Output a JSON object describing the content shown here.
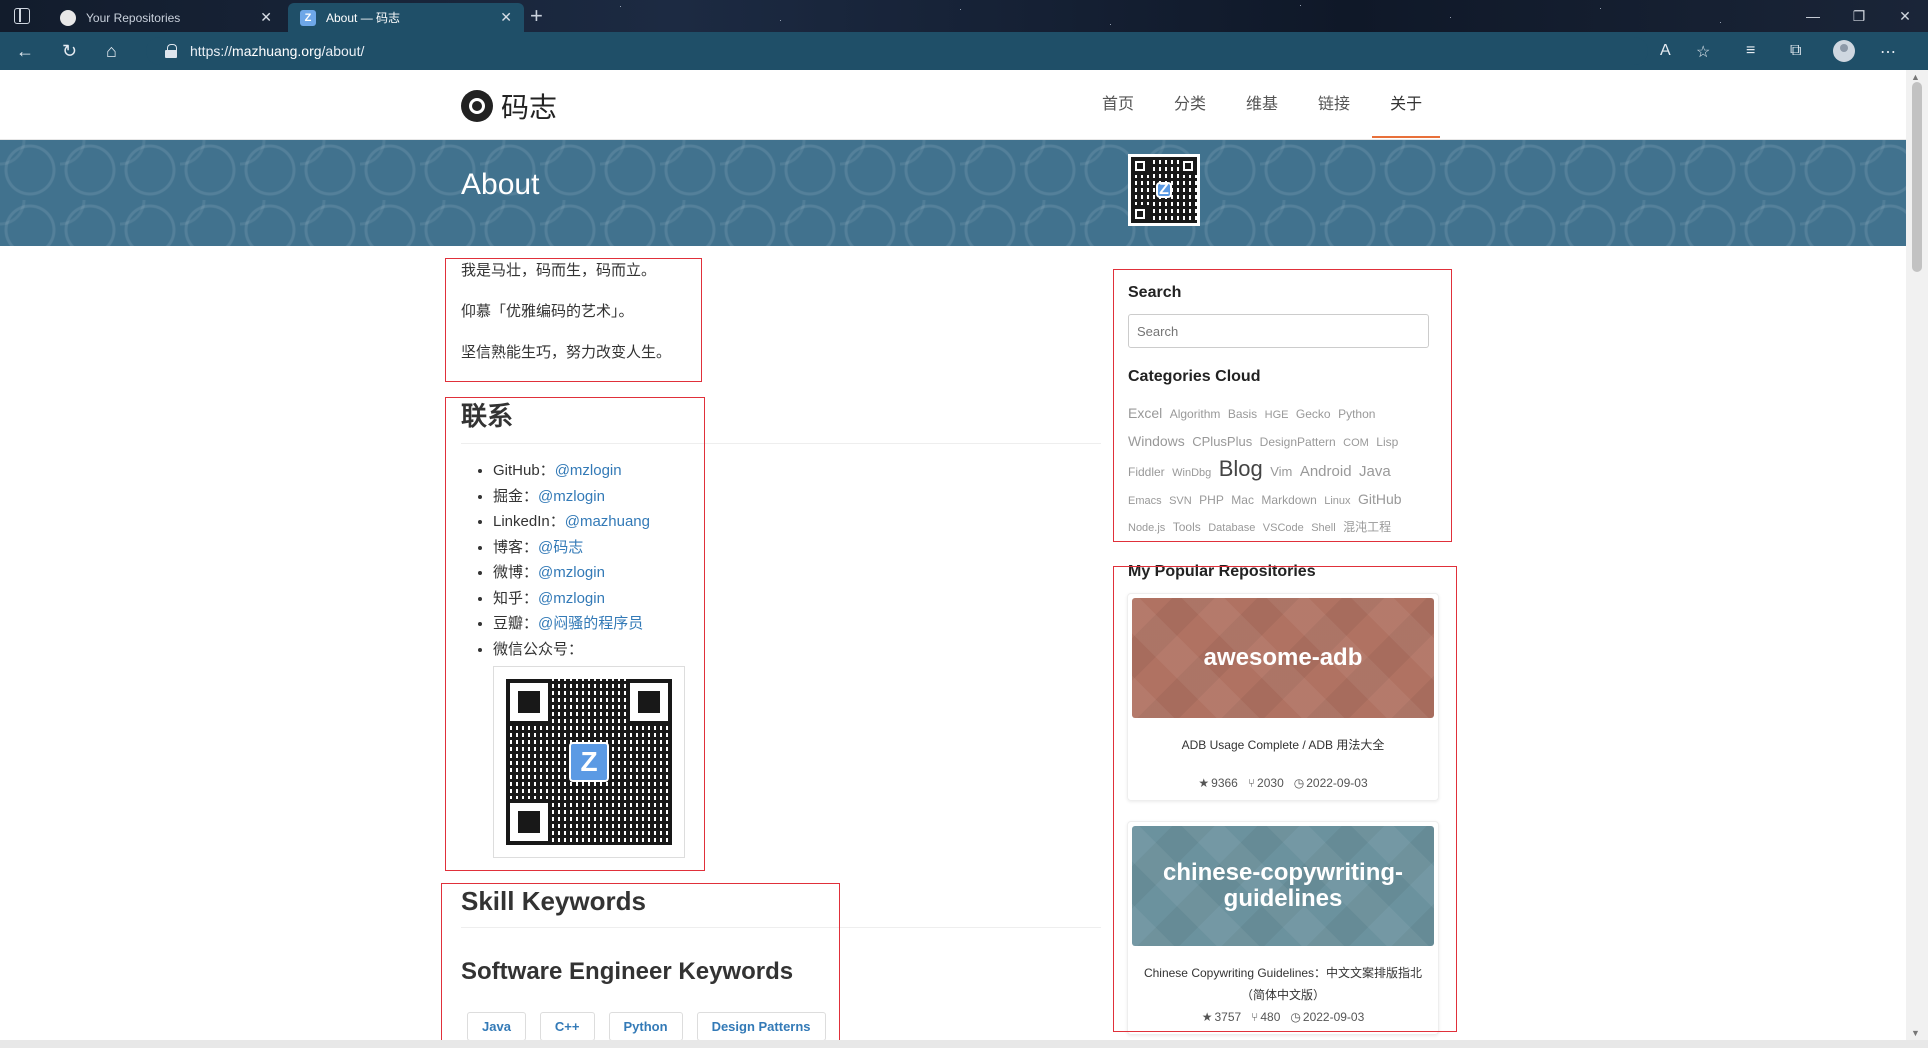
{
  "browser": {
    "tabs": [
      {
        "title": "Your Repositories",
        "active": false
      },
      {
        "title": "About — 码志",
        "active": true
      }
    ],
    "url_scheme": "https://",
    "url_host": "mazhuang.org",
    "url_path": "/about/"
  },
  "site": {
    "brand": "码志",
    "menu": [
      "首页",
      "分类",
      "维基",
      "链接",
      "关于"
    ],
    "active_menu": "关于",
    "banner_title": "About"
  },
  "intro": [
    "我是马壮，码而生，码而立。",
    "仰慕「优雅编码的艺术」。",
    "坚信熟能生巧，努力改变人生。"
  ],
  "contact": {
    "heading": "联系",
    "items": [
      {
        "label": "GitHub：",
        "link": "@mzlogin"
      },
      {
        "label": "掘金：",
        "link": "@mzlogin"
      },
      {
        "label": "LinkedIn：",
        "link": "@mazhuang"
      },
      {
        "label": "博客：",
        "link": "@码志"
      },
      {
        "label": "微博：",
        "link": "@mzlogin"
      },
      {
        "label": "知乎：",
        "link": "@mzlogin"
      },
      {
        "label": "豆瓣：",
        "link": "@闷骚的程序员"
      },
      {
        "label": "微信公众号：",
        "link": ""
      }
    ]
  },
  "skills": {
    "heading": "Skill Keywords",
    "subheading": "Software Engineer Keywords",
    "keywords": [
      "Java",
      "C++",
      "Python",
      "Design Patterns"
    ]
  },
  "sidebar": {
    "search_heading": "Search",
    "search_placeholder": "Search",
    "categories_heading": "Categories Cloud",
    "categories": [
      "Excel",
      "Algorithm",
      "Basis",
      "HGE",
      "Gecko",
      "Python",
      "Windows",
      "CPlusPlus",
      "DesignPattern",
      "COM",
      "Lisp",
      "Fiddler",
      "WinDbg",
      "Blog",
      "Vim",
      "Android",
      "Java",
      "Emacs",
      "SVN",
      "PHP",
      "Mac",
      "Markdown",
      "Linux",
      "GitHub",
      "Node.js",
      "Tools",
      "Database",
      "VSCode",
      "Shell",
      "混沌工程"
    ],
    "repos_heading": "My Popular Repositories",
    "repos": [
      {
        "name": "awesome-adb",
        "desc": "ADB Usage Complete / ADB 用法大全",
        "stars": "9366",
        "forks": "2030",
        "updated": "2022-09-03"
      },
      {
        "name": "chinese-copywriting-guidelines",
        "desc": "Chinese Copywriting Guidelines：中文文案排版指北（简体中文版）",
        "stars": "3757",
        "forks": "480",
        "updated": "2022-09-03"
      }
    ]
  },
  "colors": {
    "accent": "#e8703a",
    "link": "#337ab7",
    "banner": "#41728e",
    "annotation": "#e0303a"
  }
}
